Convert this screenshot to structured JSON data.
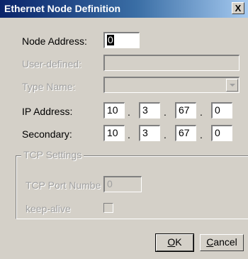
{
  "window": {
    "title": "Ethernet Node Definition",
    "close_glyph": "X"
  },
  "fields": {
    "node_address": {
      "label": "Node Address:",
      "value": "0"
    },
    "user_defined": {
      "label": "User-defined:",
      "value": ""
    },
    "type_name": {
      "label": "Type Name:",
      "value": ""
    },
    "ip_address": {
      "label": "IP Address:",
      "octets": [
        "10",
        "3",
        "67",
        "0"
      ]
    },
    "secondary": {
      "label": "Secondary:",
      "octets": [
        "10",
        "3",
        "67",
        "0"
      ]
    }
  },
  "tcp_settings": {
    "title": "TCP Settings",
    "port_label": "TCP Port Numbe",
    "port_value": "0",
    "keepalive_label": "keep-alive",
    "keepalive_checked": false
  },
  "buttons": {
    "ok": {
      "mnemonic": "O",
      "rest": "K"
    },
    "cancel": {
      "mnemonic": "C",
      "rest": "ancel"
    }
  },
  "separators": {
    "dot": "."
  },
  "colors": {
    "dialog_bg": "#d4d0c8",
    "titlebar_start": "#0a246a",
    "titlebar_end": "#a6caf0",
    "disabled_text": "#a0a0a0"
  },
  "icons": {
    "close": "close-icon",
    "dropdown": "chevron-down-icon"
  }
}
